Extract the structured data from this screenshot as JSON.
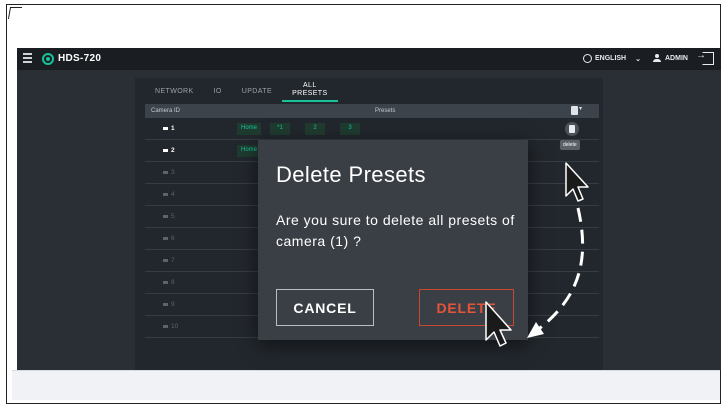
{
  "app": {
    "product_name": "HDS-720",
    "language": "ENGLISH",
    "user": "ADMIN",
    "brand_color": "#18c39a"
  },
  "tabs": [
    {
      "label": "NETWORK"
    },
    {
      "label": "IO"
    },
    {
      "label": "UPDATE"
    },
    {
      "label": "ALL\nPRESETS",
      "active": true
    }
  ],
  "table": {
    "col_camera": "Camera ID",
    "col_presets": "Presets",
    "rows": [
      {
        "camera": "1",
        "presets": [
          "Home",
          "*1",
          "2",
          "3"
        ]
      },
      {
        "camera": "2",
        "presets": [
          "Home"
        ]
      },
      {
        "camera": "3"
      },
      {
        "camera": "4"
      },
      {
        "camera": "5"
      },
      {
        "camera": "6"
      },
      {
        "camera": "7"
      },
      {
        "camera": "8"
      },
      {
        "camera": "9"
      },
      {
        "camera": "10"
      }
    ],
    "tooltip": "delete"
  },
  "dialog": {
    "title": "Delete Presets",
    "message": "Are you sure to delete all presets of camera (1) ?",
    "cancel_label": "CANCEL",
    "delete_label": "DELETE",
    "delete_color": "#e5543a"
  },
  "icons": [
    "hamburger-icon",
    "logo-icon",
    "globe-icon",
    "chevron-down-icon",
    "user-icon",
    "logout-icon",
    "trash-icon",
    "cursor-icon"
  ]
}
